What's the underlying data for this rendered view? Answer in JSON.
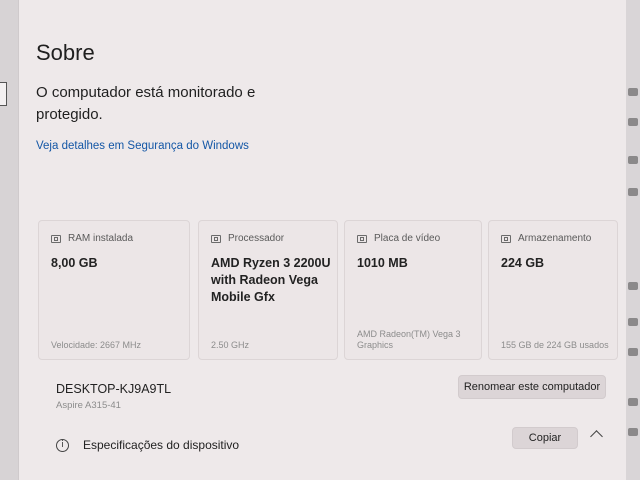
{
  "page": {
    "title": "Sobre",
    "status": "O computador está monitorado e protegido.",
    "security_link": "Veja detalhes em Segurança do Windows"
  },
  "specs": [
    {
      "icon": "ram-icon",
      "label": "RAM instalada",
      "value": "8,00 GB",
      "detail": "Velocidade: 2667 MHz"
    },
    {
      "icon": "processor-icon",
      "label": "Processador",
      "value": "AMD Ryzen 3 2200U with Radeon Vega Mobile Gfx",
      "detail": "2.50 GHz"
    },
    {
      "icon": "gpu-icon",
      "label": "Placa de vídeo",
      "value": "1010 MB",
      "detail": "AMD Radeon(TM) Vega 3 Graphics"
    },
    {
      "icon": "storage-icon",
      "label": "Armazenamento",
      "value": "224 GB",
      "detail": "155 GB de 224 GB usados"
    }
  ],
  "device": {
    "name": "DESKTOP-KJ9A9TL",
    "model": "Aspire A315-41",
    "rename_button": "Renomear este computador"
  },
  "device_specs": {
    "label": "Especificações do dispositivo",
    "copy_button": "Copiar"
  },
  "colors": {
    "background": "#eee9ea",
    "card": "#ece6e7",
    "link": "#1457a6"
  }
}
